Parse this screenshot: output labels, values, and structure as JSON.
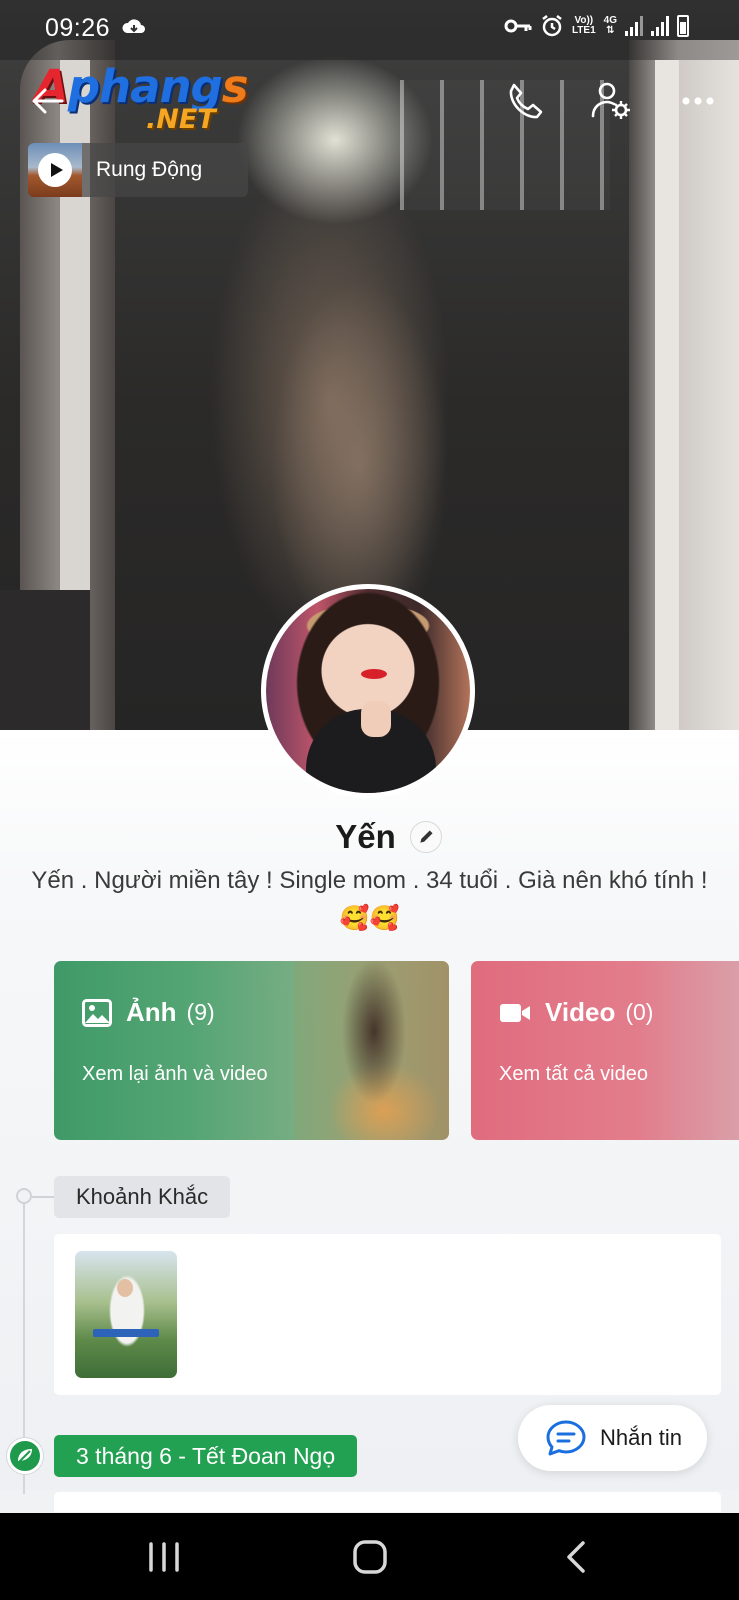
{
  "status_bar": {
    "time": "09:26",
    "network_top": "Vo))",
    "network_bottom": "LTE1",
    "network_type": "4G",
    "icons": [
      "cloud-sync-icon",
      "vpn-key-icon",
      "alarm-icon",
      "signal-icon",
      "signal-icon",
      "battery-icon"
    ]
  },
  "watermark": {
    "text_main": "Aphangs",
    "text_sub": ".NET"
  },
  "header": {
    "icons": [
      "back-arrow-icon",
      "phone-icon",
      "user-settings-icon",
      "more-icon"
    ]
  },
  "music": {
    "title": "Rung Động",
    "icon": "play-icon"
  },
  "profile": {
    "name": "Yến",
    "bio": "Yến . Người miền tây ! Single mom . 34 tuổi . Già nên khó tính ! 🥰🥰"
  },
  "media": {
    "photos": {
      "title": "Ảnh",
      "count": "(9)",
      "subtitle": "Xem lại ảnh và video",
      "color": "#3f9a68"
    },
    "videos": {
      "title": "Video",
      "count": "(0)",
      "subtitle": "Xem tất cả video",
      "color": "#e06c7e"
    }
  },
  "timeline": {
    "section_label": "Khoảnh Khắc",
    "event_label": "3 tháng 6 - Tết Đoan Ngọ",
    "event_color": "#23a152"
  },
  "message_button": {
    "label": "Nhắn tin"
  },
  "nav_bar": {
    "buttons": [
      "recents-icon",
      "home-icon",
      "back-icon"
    ]
  }
}
